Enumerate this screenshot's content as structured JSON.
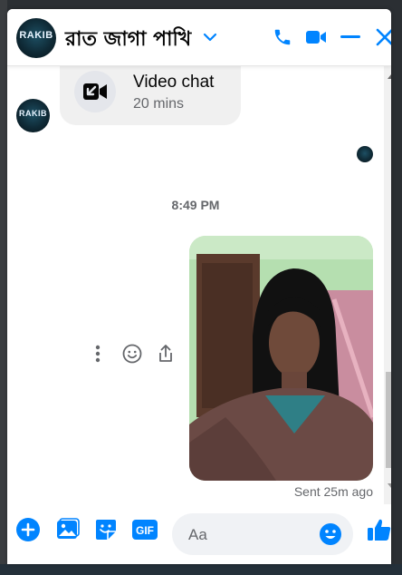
{
  "header": {
    "title": "রাত জাগা পাখি",
    "avatar_text": "RAKIB"
  },
  "messages": {
    "call": {
      "title": "Video chat",
      "duration": "20 mins"
    },
    "timestamp": "8:49 PM",
    "sent_status": "Sent 25m ago"
  },
  "composer": {
    "placeholder": "Aa"
  },
  "colors": {
    "accent": "#0084ff",
    "bubble": "#f0f0f0"
  }
}
